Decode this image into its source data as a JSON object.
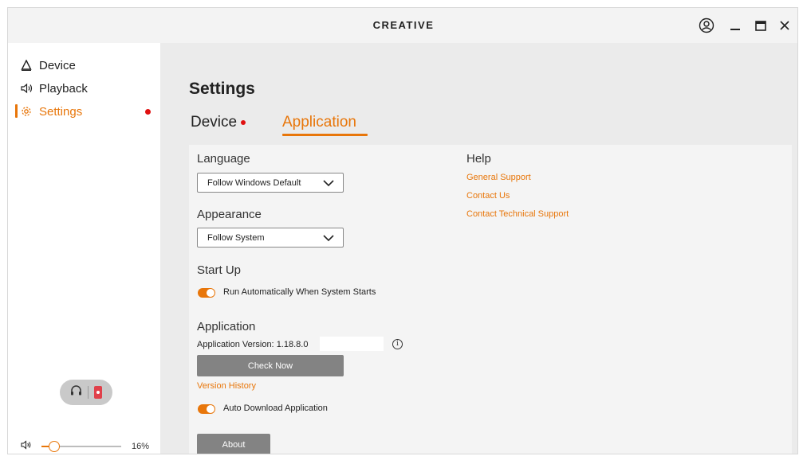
{
  "titlebar": {
    "brand": "CREATIVE",
    "icons": [
      "user-icon",
      "minimize-icon",
      "maximize-icon",
      "close-icon"
    ]
  },
  "sidebar": {
    "items": [
      {
        "label": "Device",
        "icon": "device-icon",
        "active": false
      },
      {
        "label": "Playback",
        "icon": "speaker-icon",
        "active": false
      },
      {
        "label": "Settings",
        "icon": "gear-icon",
        "active": true,
        "notification": true
      }
    ],
    "output_toggle": {
      "icons": [
        "headphones-icon",
        "speaker-box-icon"
      ],
      "selected": "speaker-box-icon"
    },
    "volume": {
      "value": 16,
      "display": "16%",
      "icon": "volume-icon"
    }
  },
  "main": {
    "title": "Settings",
    "tabs": [
      {
        "label": "Device",
        "active": false,
        "notification": true
      },
      {
        "label": "Application",
        "active": true
      }
    ],
    "language": {
      "label": "Language",
      "selected": "Follow Windows Default"
    },
    "appearance": {
      "label": "Appearance",
      "selected": "Follow System"
    },
    "startup": {
      "label": "Start Up",
      "toggle_label": "Run Automatically When System Starts",
      "enabled": true
    },
    "application": {
      "label": "Application",
      "version_label": "Application Version:",
      "version": "1.18.8.0",
      "check_button": "Check Now",
      "history_link": "Version History",
      "auto_download_label": "Auto Download Application",
      "auto_download_enabled": true,
      "about_button": "About"
    },
    "help": {
      "label": "Help",
      "links": [
        "General Support",
        "Contact Us",
        "Contact Technical Support"
      ]
    }
  },
  "colors": {
    "accent": "#e8760a",
    "notification": "#e01010",
    "button": "#838383",
    "panel": "#f4f4f4",
    "main_bg": "#ebebeb"
  }
}
